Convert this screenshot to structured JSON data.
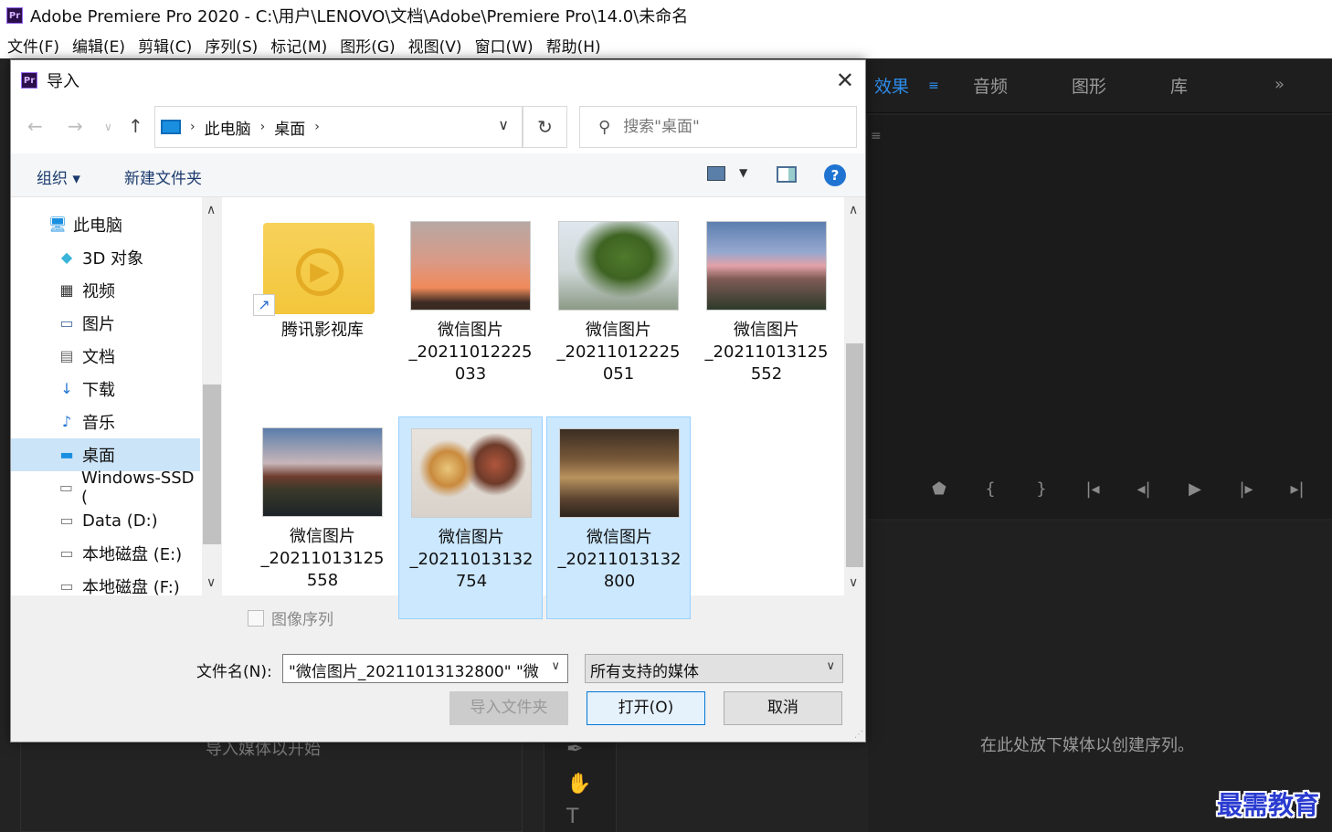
{
  "app": {
    "logo": "Pr",
    "title": "Adobe Premiere Pro 2020 - C:\\用户\\LENOVO\\文档\\Adobe\\Premiere Pro\\14.0\\未命名",
    "menu": [
      "文件(F)",
      "编辑(E)",
      "剪辑(C)",
      "序列(S)",
      "标记(M)",
      "图形(G)",
      "视图(V)",
      "窗口(W)",
      "帮助(H)"
    ]
  },
  "premiere": {
    "tabs": [
      "效果",
      "音频",
      "图形",
      "库"
    ],
    "active_tab": "效果",
    "accent": "#2d8ceb",
    "timeline_hint": "在此处放下媒体以创建序列。",
    "project_hint": "导入媒体以开始"
  },
  "watermark": "最需教育",
  "dialog": {
    "title": "导入",
    "breadcrumb": [
      "此电脑",
      "桌面"
    ],
    "search_placeholder": "搜索\"桌面\"",
    "toolbar": {
      "organize": "组织 ▾",
      "new_folder": "新建文件夹"
    },
    "nav_items": [
      {
        "label": "此电脑",
        "icon": "computer-icon"
      },
      {
        "label": "3D 对象",
        "icon": "3d-objects-icon"
      },
      {
        "label": "视频",
        "icon": "video-icon"
      },
      {
        "label": "图片",
        "icon": "pictures-icon"
      },
      {
        "label": "文档",
        "icon": "documents-icon"
      },
      {
        "label": "下载",
        "icon": "download-icon"
      },
      {
        "label": "音乐",
        "icon": "music-icon"
      },
      {
        "label": "桌面",
        "icon": "desktop-icon",
        "selected": true
      },
      {
        "label": "Windows-SSD (",
        "icon": "drive-icon"
      },
      {
        "label": "Data (D:)",
        "icon": "drive-icon"
      },
      {
        "label": "本地磁盘 (E:)",
        "icon": "drive-icon"
      },
      {
        "label": "本地磁盘 (F:)",
        "icon": "drive-icon"
      }
    ],
    "files": [
      {
        "name": "腾讯影视库",
        "kind": "folder-shortcut"
      },
      {
        "name": "微信图片\n_20211012225\n033",
        "kind": "image",
        "scene": "sunset"
      },
      {
        "name": "微信图片\n_20211012225\n051",
        "kind": "image",
        "scene": "tree"
      },
      {
        "name": "微信图片\n_20211013125\n552",
        "kind": "image",
        "scene": "campus-dusk"
      },
      {
        "name": "微信图片\n_20211013125\n558",
        "kind": "image",
        "scene": "river"
      },
      {
        "name": "微信图片\n_20211013132\n754",
        "kind": "image",
        "scene": "food",
        "selected": true
      },
      {
        "name": "微信图片\n_20211013132\n800",
        "kind": "image",
        "scene": "restaurant",
        "selected": true
      }
    ],
    "image_sequence_label": "图像序列",
    "filename_label": "文件名(N):",
    "filename_value": "\"微信图片_20211013132800\" \"微",
    "filetype_value": "所有支持的媒体",
    "buttons": {
      "import_folder": "导入文件夹",
      "open": "打开(O)",
      "cancel": "取消"
    }
  }
}
